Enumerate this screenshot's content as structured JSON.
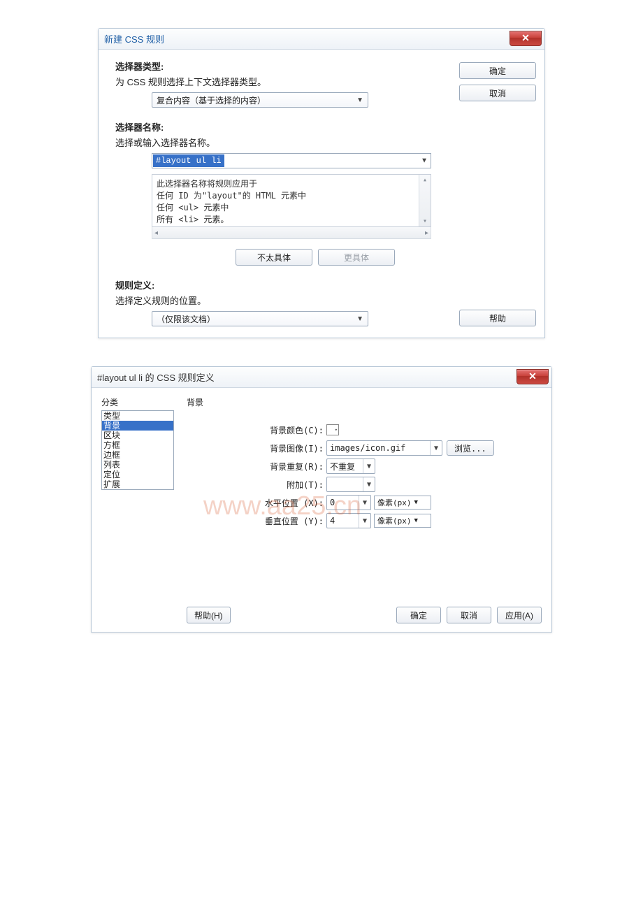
{
  "dialog1": {
    "title": "新建 CSS 规则",
    "selector_type_label": "选择器类型:",
    "selector_type_desc": "为 CSS 规则选择上下文选择器类型。",
    "selector_type_value": "复合内容（基于选择的内容）",
    "selector_name_label": "选择器名称:",
    "selector_name_desc": "选择或输入选择器名称。",
    "selector_name_value": "#layout ul li",
    "selector_explain_line1": "此选择器名称将规则应用于",
    "selector_explain_line2": "任何 ID 为\"layout\"的 HTML 元素中",
    "selector_explain_line3": "任何 <ul> 元素中",
    "selector_explain_line4": "所有 <li> 元素。",
    "less_specific_btn": "不太具体",
    "more_specific_btn": "更具体",
    "rule_def_label": "规则定义:",
    "rule_def_desc": "选择定义规则的位置。",
    "rule_def_value": "（仅限该文档）",
    "ok_btn": "确定",
    "cancel_btn": "取消",
    "help_btn": "帮助"
  },
  "dialog2": {
    "title": "#layout ul li 的 CSS 规则定义",
    "category_label": "分类",
    "categories": {
      "c0": "类型",
      "c1": "背景",
      "c2": "区块",
      "c3": "方框",
      "c4": "边框",
      "c5": "列表",
      "c6": "定位",
      "c7": "扩展"
    },
    "panel_title": "背景",
    "bg_color_label": "背景颜色(C):",
    "bg_image_label": "背景图像(I):",
    "bg_image_value": "images/icon.gif",
    "browse_btn": "浏览...",
    "bg_repeat_label": "背景重复(R):",
    "bg_repeat_value": "不重复",
    "bg_attach_label": "附加(T):",
    "bg_attach_value": "",
    "bg_posx_label": "水平位置 (X):",
    "bg_posx_value": "0",
    "bg_posy_label": "垂直位置 (Y):",
    "bg_posy_value": "4",
    "unit_px": "像素(px)",
    "help_btn": "帮助(H)",
    "ok_btn": "确定",
    "cancel_btn": "取消",
    "apply_btn": "应用(A)"
  },
  "watermark": "www.aa25.cn"
}
